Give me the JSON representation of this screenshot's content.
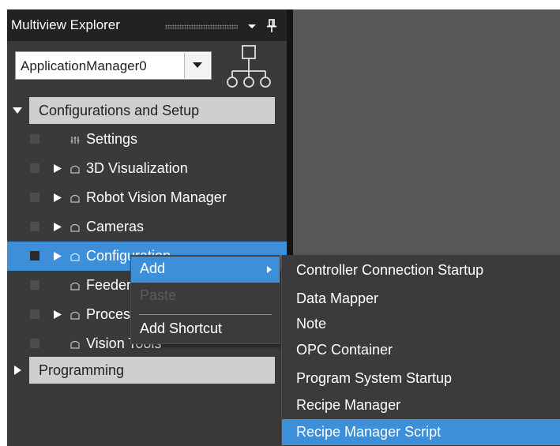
{
  "panel": {
    "title": "Multiview Explorer",
    "application_selector": {
      "value": "ApplicationManager0"
    }
  },
  "groups": [
    {
      "label": "Configurations and Setup",
      "expanded": true
    },
    {
      "label": "Programming",
      "expanded": false
    }
  ],
  "tree_items": [
    {
      "label": "Settings",
      "icon": "settings-icon",
      "has_expander": false
    },
    {
      "label": "3D Visualization",
      "icon": "folder-icon",
      "has_expander": true
    },
    {
      "label": "Robot Vision Manager",
      "icon": "folder-icon",
      "has_expander": true
    },
    {
      "label": "Cameras",
      "icon": "folder-icon",
      "has_expander": true
    },
    {
      "label": "Configuration",
      "icon": "folder-icon",
      "has_expander": true,
      "selected": true
    },
    {
      "label": "Feeders",
      "icon": "folder-icon",
      "has_expander": false
    },
    {
      "label": "Process",
      "icon": "folder-icon",
      "has_expander": true
    },
    {
      "label": "Vision Tools",
      "icon": "folder-icon",
      "has_expander": false
    }
  ],
  "context_menu": {
    "items": [
      {
        "label": "Add",
        "has_submenu": true,
        "highlighted": true
      },
      {
        "label": "Paste",
        "enabled": false
      },
      {
        "label": "Add Shortcut",
        "enabled": true
      }
    ]
  },
  "submenu": {
    "items": [
      {
        "label": "Controller Connection Startup"
      },
      {
        "label": "Data Mapper"
      },
      {
        "label": "Note"
      },
      {
        "label": "OPC Container"
      },
      {
        "label": "Program System Startup"
      },
      {
        "label": "Recipe Manager"
      },
      {
        "label": "Recipe Manager Script",
        "highlighted": true
      }
    ]
  },
  "colors": {
    "panel_background": "#3a3a3a",
    "title_bar": "#222222",
    "selection": "#3d8fd9",
    "group_header": "#cfcfcf",
    "workspace": "#575757"
  }
}
